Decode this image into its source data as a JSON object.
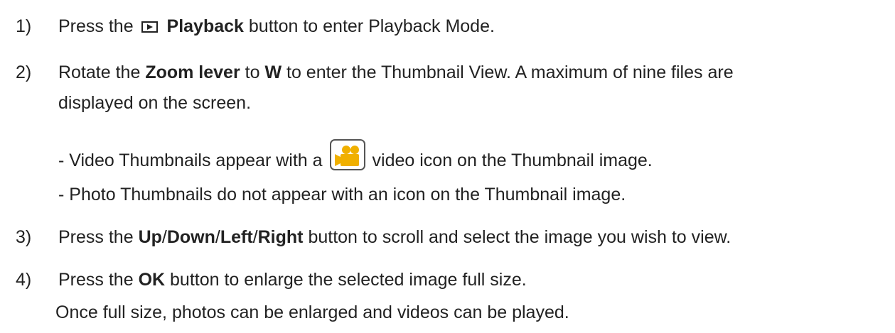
{
  "steps": [
    {
      "num": "1)",
      "pre": "Press the",
      "bold1": "Playback",
      "post": "button to enter Playback Mode."
    },
    {
      "num": "2)",
      "pre": "Rotate the",
      "bold1": "Zoom lever",
      "mid": "to",
      "bold2": "W",
      "post": "to enter the Thumbnail View. A maximum of nine files are",
      "cont": "displayed on the screen."
    },
    {
      "num": "3)",
      "pre": "Press the",
      "b1": "Up",
      "b2": "Down",
      "b3": "Left",
      "b4": "Right",
      "sep": "/",
      "post": "button to scroll and select the image you wish to view."
    },
    {
      "num": "4)",
      "pre": "Press the",
      "bold1": "OK",
      "post": "button to enlarge the selected image full size.",
      "cont": "Once full size, photos can be enlarged and videos can be played."
    }
  ],
  "bullets": [
    {
      "pre": "- Video Thumbnails appear with a",
      "post": "video icon on the Thumbnail image."
    },
    {
      "text": "- Photo Thumbnails do not appear with an icon on the Thumbnail image."
    }
  ],
  "icons": {
    "playback": "playback-icon",
    "video": "video-camera-icon",
    "video_color": "#f0b000"
  }
}
